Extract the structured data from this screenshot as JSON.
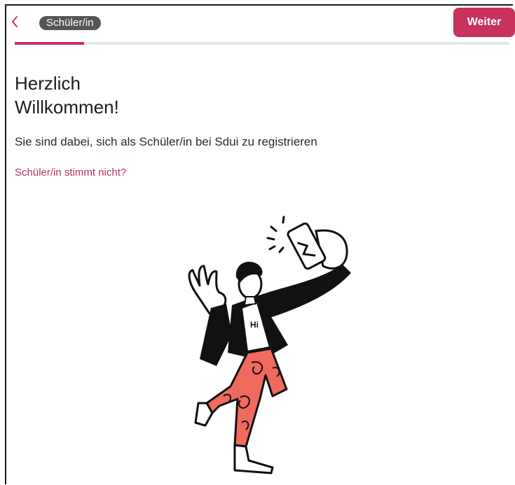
{
  "header": {
    "back_icon": "chevron-left-icon",
    "role_chip": "Schüler/in",
    "next_label": "Weiter",
    "accent_color": "#c8325c"
  },
  "progress": {
    "fraction": 0.14
  },
  "main": {
    "title": "Herzlich\nWillkommen!",
    "subtitle": "Sie sind dabei, sich als Schüler/in bei Sdui zu registrieren",
    "wrong_role_link": "Schüler/in stimmt nicht?"
  },
  "illustration": {
    "shirt_text": "Hi",
    "pants_color": "#f06a5e"
  }
}
